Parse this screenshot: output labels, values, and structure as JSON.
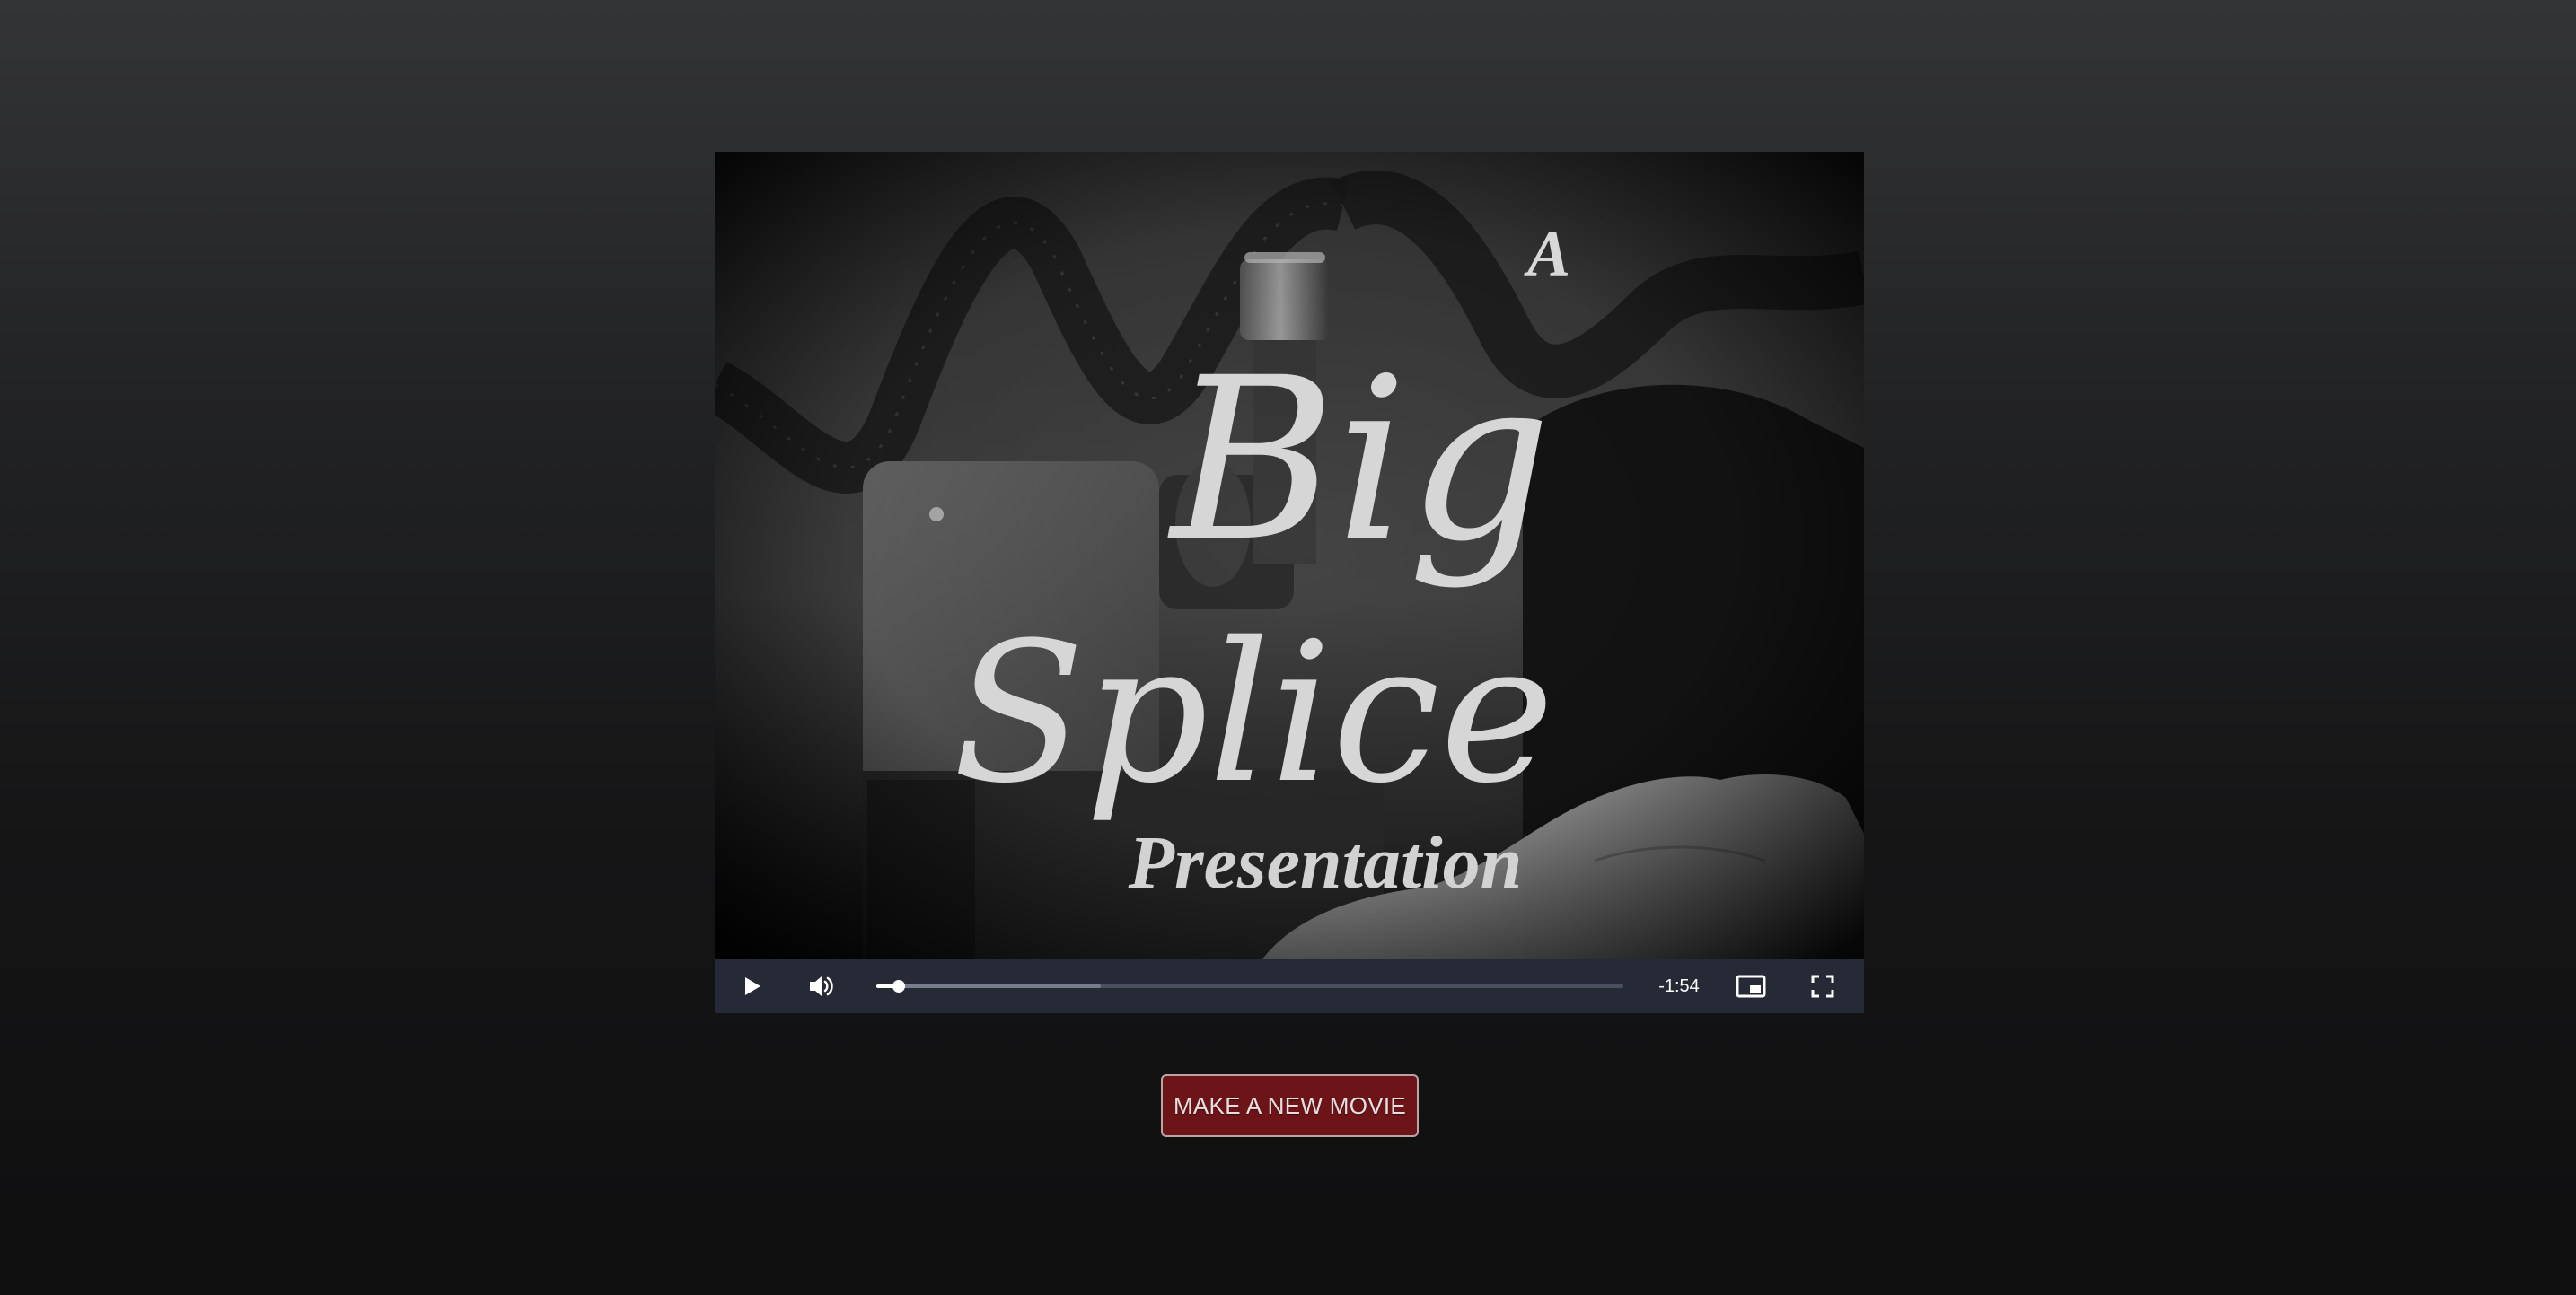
{
  "video": {
    "title_lines": [
      "A",
      "Big",
      "Splice",
      "Presentation"
    ],
    "time_remaining": "-1:54",
    "progress_played": 0.03,
    "progress_buffered": 0.3
  },
  "controls": {
    "icons": [
      "play-icon",
      "volume-icon",
      "picture-in-picture-icon",
      "fullscreen-icon"
    ]
  },
  "actions": {
    "new_movie_label": "MAKE A NEW MOVIE"
  },
  "colors": {
    "button_bg": "#6c1418",
    "control_bar": "#262c38"
  }
}
